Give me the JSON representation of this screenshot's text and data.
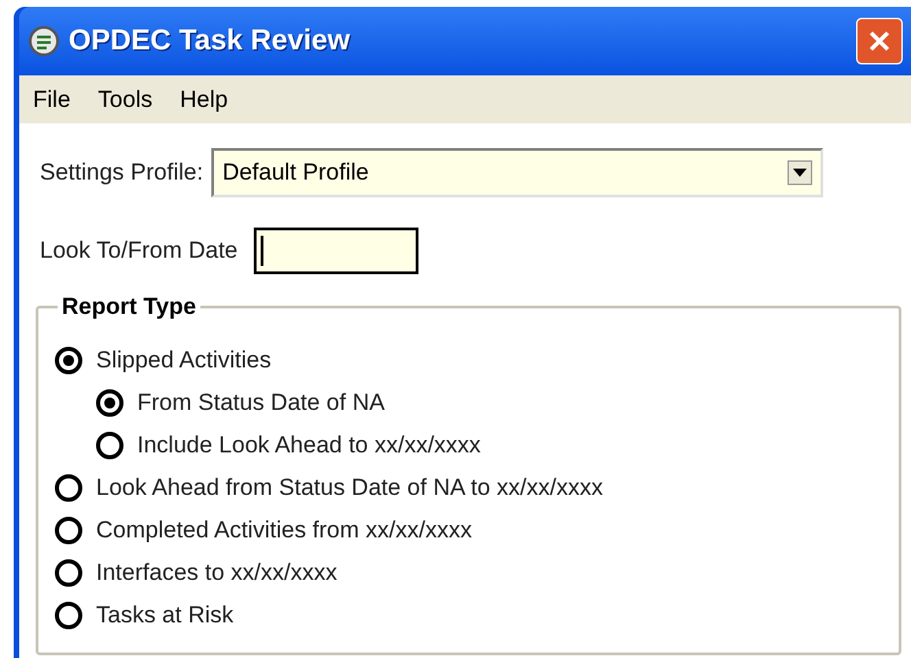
{
  "window": {
    "title": "OPDEC Task Review"
  },
  "menu": [
    "File",
    "Tools",
    "Help"
  ],
  "settings_profile": {
    "label": "Settings Profile:",
    "value": "Default Profile"
  },
  "look_date": {
    "label": "Look To/From Date"
  },
  "report_type": {
    "title": "Report Type",
    "options": [
      {
        "label": "Slipped Activities",
        "selected": true,
        "children": [
          {
            "label": "From Status Date of NA",
            "selected": true
          },
          {
            "label": "Include Look Ahead to xx/xx/xxxx",
            "selected": false
          }
        ]
      },
      {
        "label": "Look Ahead from Status Date of NA to xx/xx/xxxx",
        "selected": false
      },
      {
        "label": "Completed Activities from xx/xx/xxxx",
        "selected": false
      },
      {
        "label": "Interfaces to xx/xx/xxxx",
        "selected": false
      },
      {
        "label": "Tasks at Risk",
        "selected": false
      }
    ]
  }
}
